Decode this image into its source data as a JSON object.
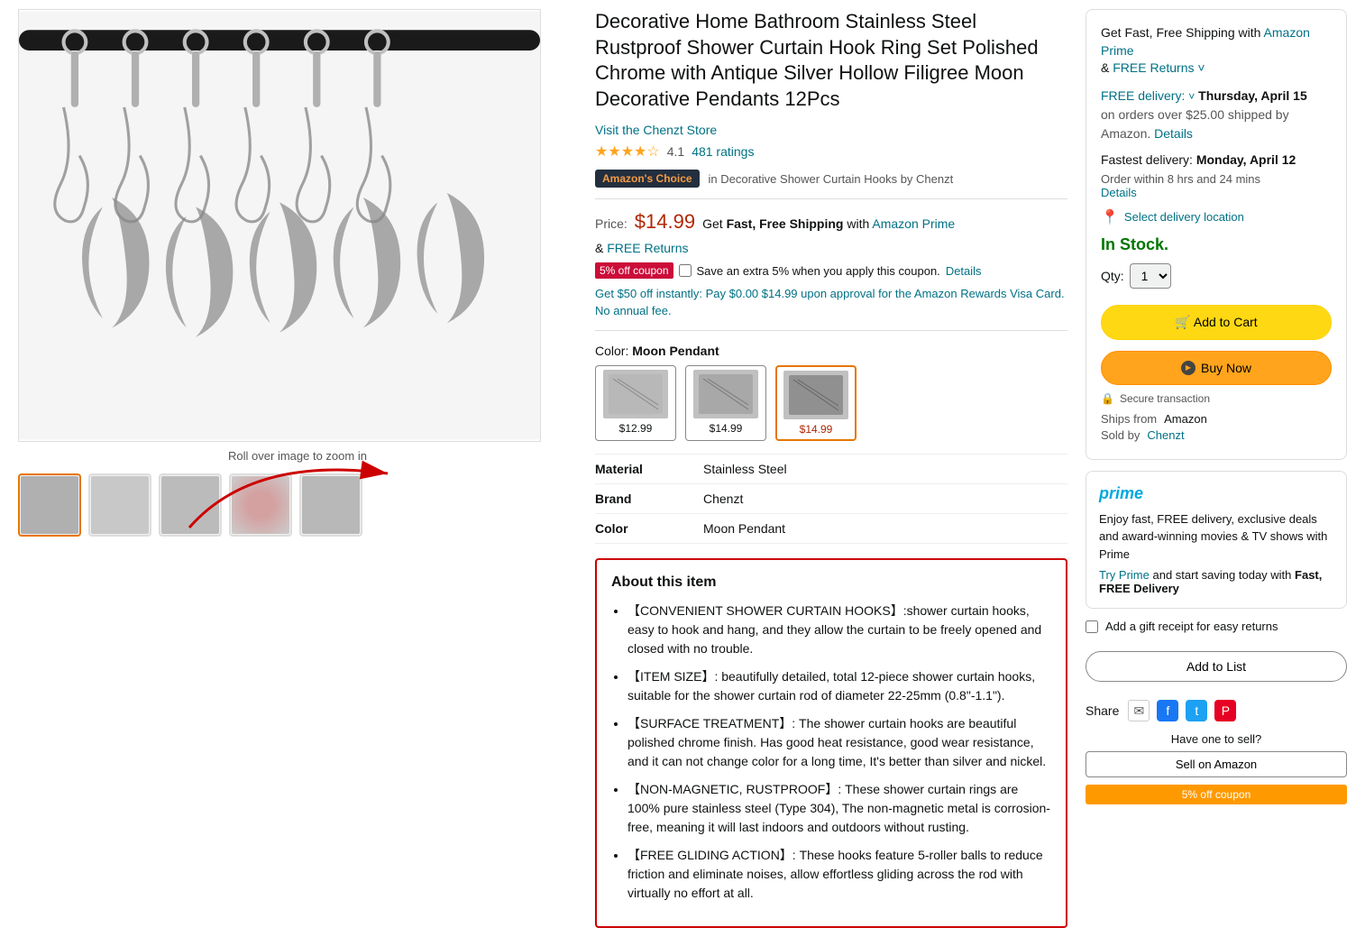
{
  "product": {
    "title": "Decorative Home Bathroom Stainless Steel Rustproof Shower Curtain Hook Ring Set Polished Chrome with Antique Silver Hollow Filigree Moon Decorative Pendants 12Pcs",
    "store": "Visit the Chenzt Store",
    "rating": "4.1",
    "rating_stars": "★★★★☆",
    "rating_count": "481 ratings",
    "amazon_choice": "Amazon's Choice",
    "choice_category": "in Decorative Shower Curtain Hooks by Chenzt",
    "price": "$14.99",
    "get_fast": "Get",
    "fast_free": "Fast, Free Shipping",
    "with": "with",
    "amazon_prime_text": "Amazon Prime",
    "and": "&",
    "free_returns": "FREE Returns",
    "coupon_label": "Coupon",
    "coupon_text": "Save an extra 5% when you apply this coupon.",
    "coupon_details": "Details",
    "promo_text": "Get $50 off instantly: Pay $0.00 $14.99 upon approval for the Amazon Rewards Visa Card. No annual fee.",
    "color_label": "Color:",
    "color_name": "Moon Pendant",
    "zoom_text": "Roll over image to zoom in",
    "material": "Stainless Steel",
    "brand": "Chenzt",
    "color": "Moon Pendant",
    "thumbnails": [
      "thumb1",
      "thumb2",
      "thumb3",
      "thumb4",
      "thumb5"
    ]
  },
  "color_options": [
    {
      "price": "$12.99",
      "selected": false
    },
    {
      "price": "$14.99",
      "selected": false
    },
    {
      "price": "$14.99",
      "selected": true
    }
  ],
  "about": {
    "title": "About this item",
    "items": [
      "【CONVENIENT SHOWER CURTAIN HOOKS】:shower curtain hooks, easy to hook and hang, and they allow the curtain to be freely opened and closed with no trouble.",
      "【ITEM SIZE】: beautifully detailed, total 12-piece shower curtain hooks, suitable for the shower curtain rod of diameter 22-25mm (0.8\"-1.1\").",
      "【SURFACE TREATMENT】: The shower curtain hooks are beautiful polished chrome finish. Has good heat resistance, good wear resistance, and it can not change color for a long time, It's better than silver and nickel.",
      "【NON-MAGNETIC, RUSTPROOF】: These shower curtain rings are 100% pure stainless steel (Type 304), The non-magnetic metal is corrosion-free, meaning it will last indoors and outdoors without rusting.",
      "【FREE GLIDING ACTION】: These hooks feature 5-roller balls to reduce friction and eliminate noises, allow effortless gliding across the rod with virtually no effort at all."
    ]
  },
  "purchase_box": {
    "get_fast_text": "Get Fast, Free Shipping with",
    "amazon_prime": "Amazon Prime",
    "and": "&",
    "free_returns": "FREE Returns",
    "free_delivery_label": "FREE delivery:",
    "delivery_day": "Thursday, April 15",
    "delivery_condition": "on orders over $25.00 shipped by Amazon.",
    "details": "Details",
    "fastest_label": "Fastest delivery:",
    "fastest_date": "Monday, April 12",
    "order_within": "Order within 8 hrs and 24 mins",
    "details2": "Details",
    "select_location": "Select delivery location",
    "in_stock": "In Stock.",
    "qty_label": "Qty:",
    "qty_value": "1",
    "add_to_cart": "Add to Cart",
    "buy_now": "Buy Now",
    "secure_transaction": "Secure transaction",
    "ships_from_label": "Ships from",
    "ships_from_val": "Amazon",
    "sold_by_label": "Sold by",
    "sold_by_val": "Chenzt",
    "prime_desc": "Enjoy fast, FREE delivery, exclusive deals and award-winning movies & TV shows with Prime",
    "try_prime": "Try Prime",
    "prime_save": "and start saving today with",
    "fast_free_delivery": "Fast, FREE Delivery",
    "gift_receipt": "Add a gift receipt for easy returns",
    "add_to_list": "Add to List",
    "share_label": "Share",
    "have_to_sell": "Have one to sell?",
    "sell_on_amazon": "Sell on Amazon",
    "coupon_banner": "5% off coupon"
  },
  "specs": [
    {
      "key": "Material",
      "value": "Stainless Steel"
    },
    {
      "key": "Brand",
      "value": "Chenzt"
    },
    {
      "key": "Color",
      "value": "Moon Pendant"
    }
  ]
}
